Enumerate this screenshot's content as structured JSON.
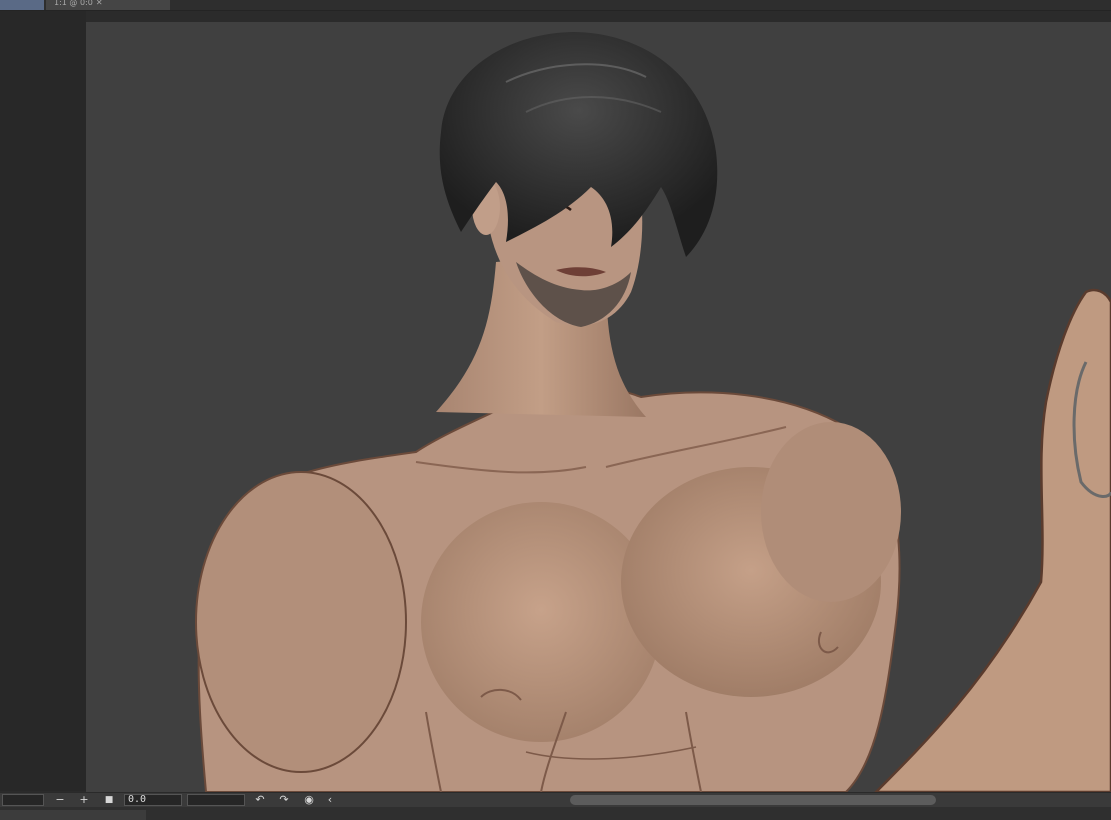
{
  "document_tab": {
    "label": "1:1 @ 0:0"
  },
  "statusbar": {
    "angle_value": "0.0",
    "zoom_out_glyph": "−",
    "zoom_in_glyph": "+",
    "stop_glyph": "■",
    "rotate_left_glyph": "↶",
    "rotate_right_glyph": "↷",
    "reset_glyph": "◉",
    "collapse_glyph": "‹"
  },
  "colors": {
    "canvas_bg": "#404040",
    "skin": "#bf9a81",
    "hair": "#2b2b2b"
  }
}
